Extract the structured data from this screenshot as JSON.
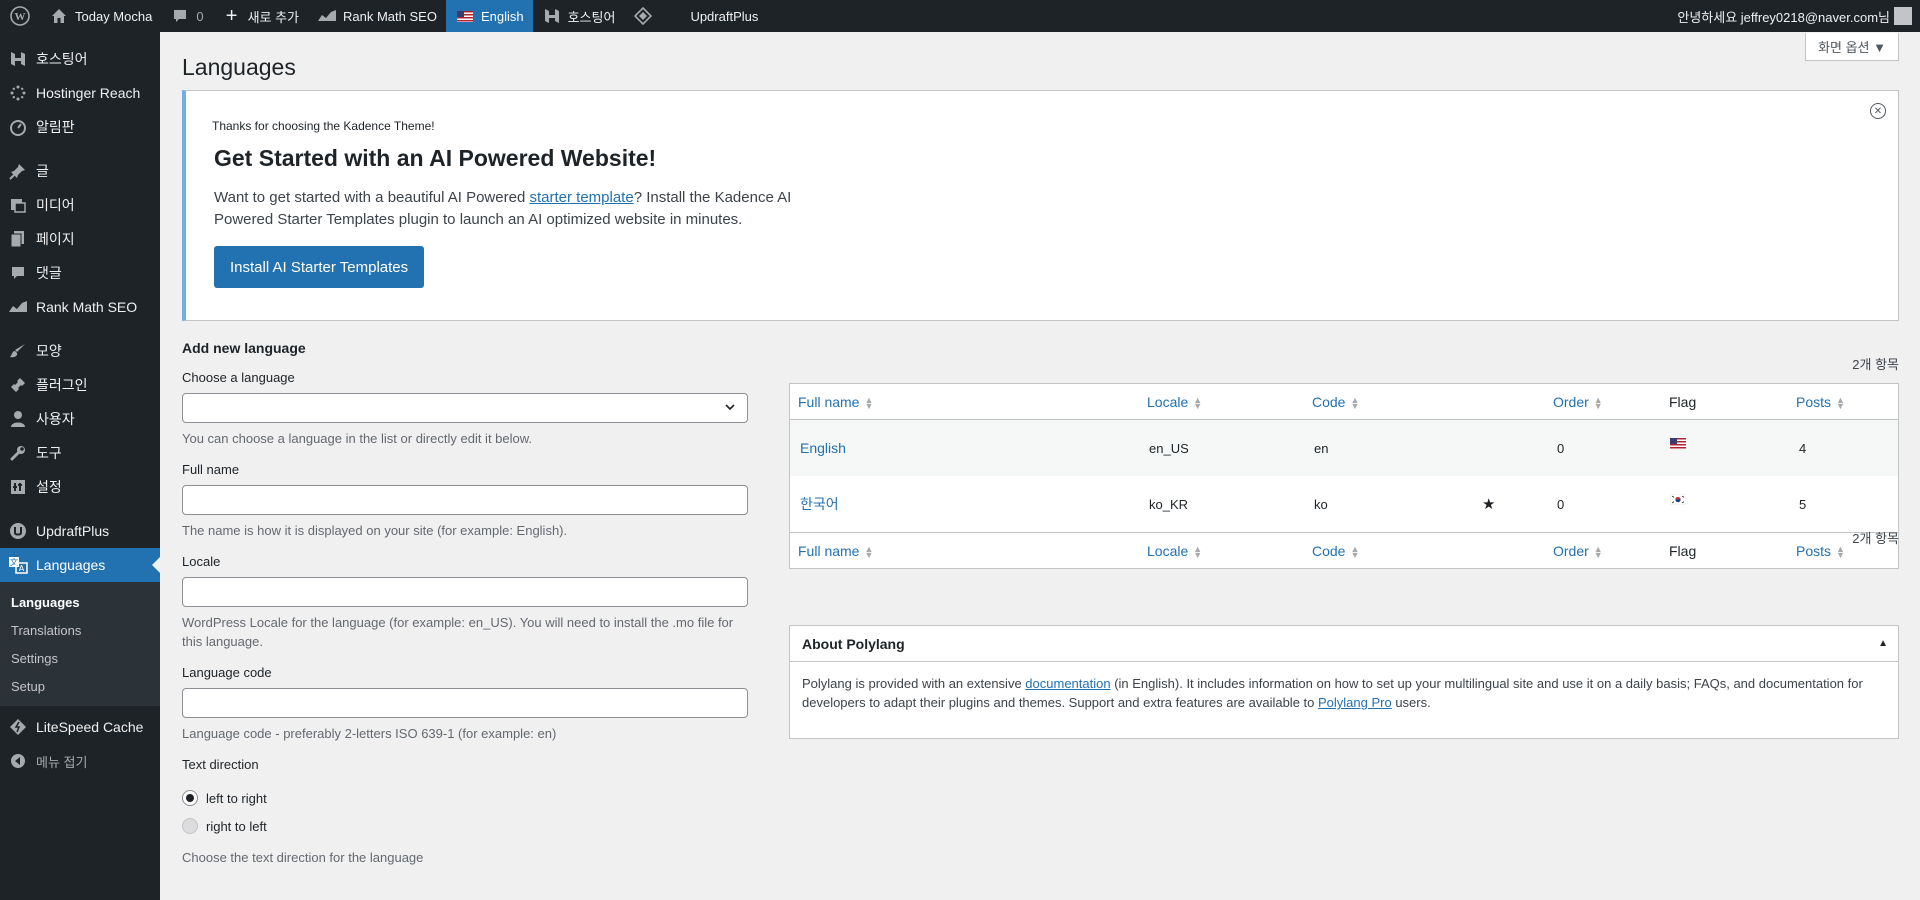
{
  "admin_bar": {
    "site_name": "Today Mocha",
    "comments_count": "0",
    "new_label": "새로 추가",
    "rankmath_label": "Rank Math SEO",
    "language_label": "English",
    "hosting_label": "호스팅어",
    "updraft_label": "UpdraftPlus",
    "greeting": "안녕하세요 jeffrey0218@naver.com님"
  },
  "sidebar": {
    "items": [
      {
        "label": "호스팅어",
        "icon": "hostinger-icon"
      },
      {
        "label": "Hostinger Reach",
        "icon": "reach-icon"
      },
      {
        "label": "알림판",
        "icon": "dashboard-icon"
      },
      {
        "label": "글",
        "icon": "pin-icon"
      },
      {
        "label": "미디어",
        "icon": "media-icon"
      },
      {
        "label": "페이지",
        "icon": "page-icon"
      },
      {
        "label": "댓글",
        "icon": "comment-icon"
      },
      {
        "label": "Rank Math SEO",
        "icon": "rankmath-icon"
      },
      {
        "label": "모양",
        "icon": "brush-icon"
      },
      {
        "label": "플러그인",
        "icon": "plugin-icon"
      },
      {
        "label": "사용자",
        "icon": "user-icon"
      },
      {
        "label": "도구",
        "icon": "wrench-icon"
      },
      {
        "label": "설정",
        "icon": "settings-icon"
      },
      {
        "label": "UpdraftPlus",
        "icon": "updraft-icon"
      },
      {
        "label": "Languages",
        "icon": "languages-icon"
      }
    ],
    "submenu": [
      "Languages",
      "Translations",
      "Settings",
      "Setup"
    ],
    "litespeed": "LiteSpeed Cache",
    "collapse": "메뉴 접기"
  },
  "header": {
    "screen_options": "화면 옵션 ▼",
    "title": "Languages"
  },
  "notice": {
    "small": "Thanks for choosing the Kadence Theme!",
    "title": "Get Started with an AI Powered Website!",
    "text_before": "Want to get started with a beautiful AI Powered ",
    "text_link": "starter template",
    "text_after": "? Install the Kadence AI Powered Starter Templates plugin to launch an AI optimized website in minutes.",
    "button": "Install AI Starter Templates"
  },
  "form": {
    "heading": "Add new language",
    "choose_label": "Choose a language",
    "choose_desc": "You can choose a language in the list or directly edit it below.",
    "fullname_label": "Full name",
    "fullname_desc": "The name is how it is displayed on your site (for example: English).",
    "locale_label": "Locale",
    "locale_desc": "WordPress Locale for the language (for example: en_US). You will need to install the .mo file for this language.",
    "code_label": "Language code",
    "code_desc": "Language code - preferably 2-letters ISO 639-1 (for example: en)",
    "direction_label": "Text direction",
    "ltr": "left to right",
    "rtl": "right to left",
    "direction_desc": "Choose the text direction for the language"
  },
  "table": {
    "count": "2개 항목",
    "columns": {
      "fullname": "Full name",
      "locale": "Locale",
      "code": "Code",
      "order": "Order",
      "flag": "Flag",
      "posts": "Posts"
    },
    "rows": [
      {
        "name": "English",
        "locale": "en_US",
        "code": "en",
        "default": "",
        "order": "0",
        "flag": "us-flag-icon",
        "posts": "4"
      },
      {
        "name": "한국어",
        "locale": "ko_KR",
        "code": "ko",
        "default": "★",
        "order": "0",
        "flag": "kr-flag-icon",
        "posts": "5"
      }
    ]
  },
  "about": {
    "title": "About Polylang",
    "toggle": "▲",
    "text1": "Polylang is provided with an extensive ",
    "link1": "documentation",
    "text2": " (in English). It includes information on how to set up your multilingual site and use it on a daily basis; FAQs, and documentation for developers to adapt their plugins and themes. Support and extra features are available to ",
    "link2": "Polylang Pro",
    "text3": " users."
  },
  "colors": {
    "accent": "#2271b1",
    "admin_dark": "#1d2327"
  }
}
